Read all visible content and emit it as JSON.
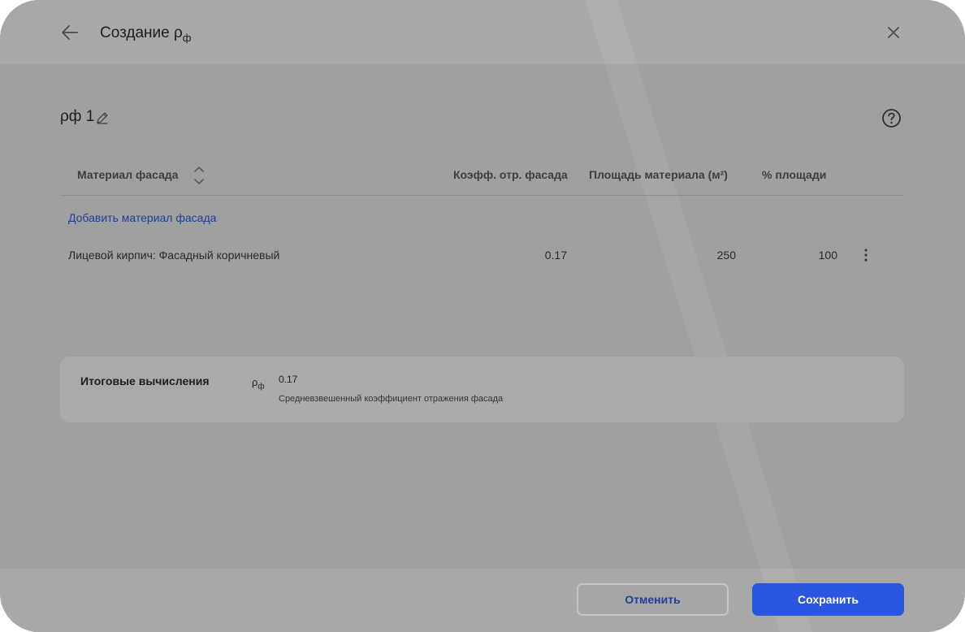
{
  "header": {
    "title": "Создание ρ",
    "title_subscript": "ф"
  },
  "facade": {
    "name": "ρф 1"
  },
  "table": {
    "columns": {
      "material": "Материал фасада",
      "coefficient": "Коэфф. отр. фасада",
      "area": "Площадь материала (м²)",
      "percent": "% площади"
    },
    "add_link": "Добавить материал фасада",
    "rows": [
      {
        "material": "Лицевой кирпич: Фасадный коричневый",
        "coefficient": "0.17",
        "area": "250",
        "percent": "100"
      }
    ]
  },
  "summary": {
    "label": "Итоговые вычисления",
    "symbol": "ρ",
    "symbol_subscript": "ф",
    "value": "0.17",
    "description": "Средневзвешенный коэффициент отражения фасада"
  },
  "footer": {
    "cancel_label": "Отменить",
    "save_label": "Сохранить"
  },
  "icons": {
    "back": "arrow-left-icon",
    "close": "close-icon",
    "edit": "pencil-icon",
    "help": "question-circle-icon",
    "sort": "sort-icon",
    "more": "kebab-menu-icon"
  },
  "colors": {
    "primary": "#2a56e0",
    "link": "#1d3f9e"
  }
}
